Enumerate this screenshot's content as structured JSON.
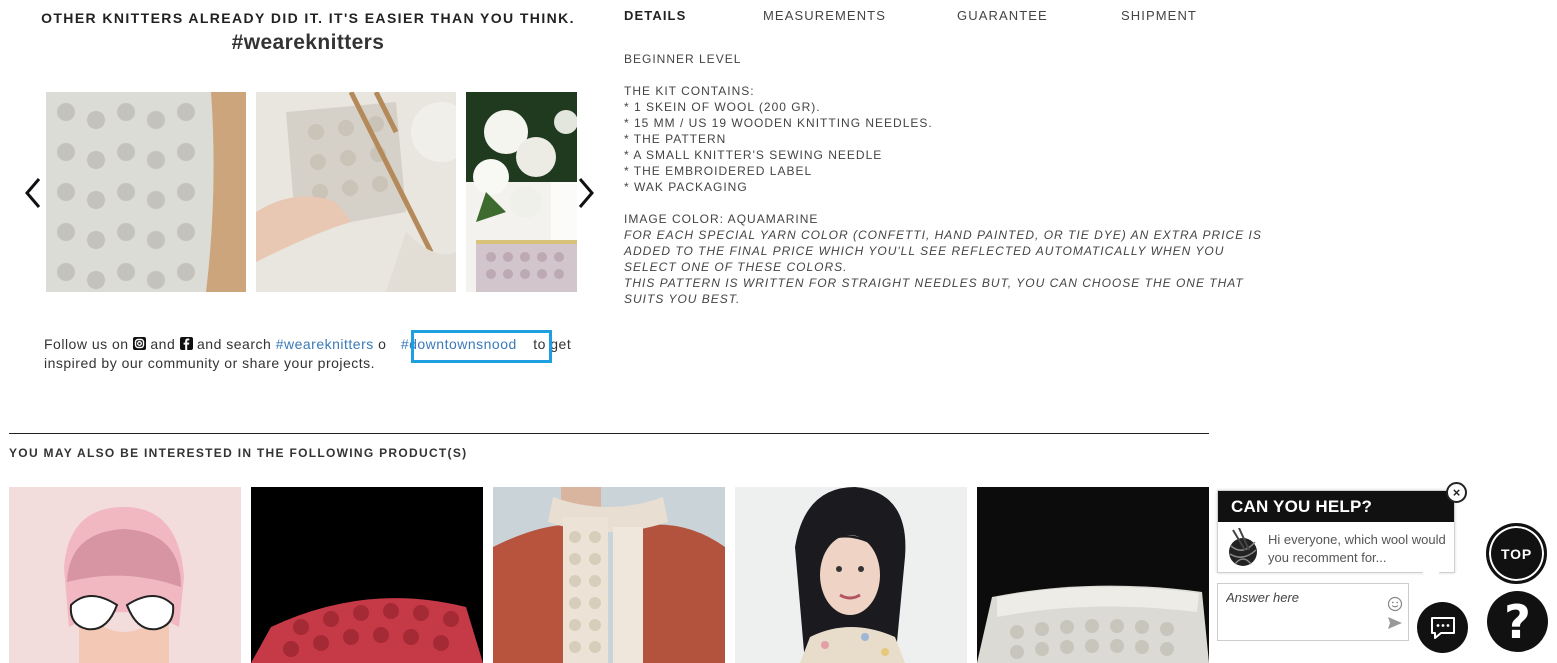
{
  "community": {
    "tagline": "OTHER KNITTERS ALREADY DID IT. IT'S EASIER THAN YOU THINK.",
    "hashtag": "#weareknitters",
    "follow_prefix": "Follow us on",
    "follow_and": "and",
    "follow_search": "and search",
    "tag1": "#weareknitters",
    "or": "o",
    "tag2": "#downtownsnood",
    "follow_suffix": "to get",
    "follow_line2": "inspired by our community or share your projects."
  },
  "tabs": [
    {
      "label": "DETAILS",
      "active": true
    },
    {
      "label": "MEASUREMENTS",
      "active": false
    },
    {
      "label": "GUARANTEE",
      "active": false
    },
    {
      "label": "SHIPMENT",
      "active": false
    }
  ],
  "details": {
    "level": "BEGINNER LEVEL",
    "kit_title": "THE KIT CONTAINS:",
    "kit_items": [
      "* 1 SKEIN OF WOOL (200 GR).",
      "* 15 MM / US 19 WOODEN KNITTING NEEDLES.",
      "* THE PATTERN",
      "* A SMALL KNITTER'S SEWING NEEDLE",
      "* THE EMBROIDERED LABEL",
      "* WAK PACKAGING"
    ],
    "color": "IMAGE COLOR: AQUAMARINE",
    "notes": [
      "FOR EACH SPECIAL YARN COLOR (CONFETTI, HAND PAINTED, OR TIE DYE) AN EXTRA PRICE IS",
      "ADDED TO THE FINAL PRICE WHICH YOU'LL SEE REFLECTED AUTOMATICALLY WHEN YOU",
      "SELECT ONE OF THESE COLORS.",
      "THIS PATTERN IS WRITTEN FOR STRAIGHT NEEDLES BUT, YOU CAN CHOOSE THE ONE THAT",
      "SUITS YOU BEST."
    ]
  },
  "related": {
    "title": "YOU MAY ALSO BE INTERESTED IN THE FOLLOWING PRODUCT(S)"
  },
  "chat": {
    "title": "CAN YOU HELP?",
    "message": "Hi everyone, which wool would you recomment for...",
    "answer_placeholder": "Answer here",
    "close": "×"
  },
  "top_button": "TOP",
  "help_button": "?",
  "colors": {
    "link": "#3a7ab8",
    "highlight": "#1ea0e0",
    "dark": "#111111"
  }
}
